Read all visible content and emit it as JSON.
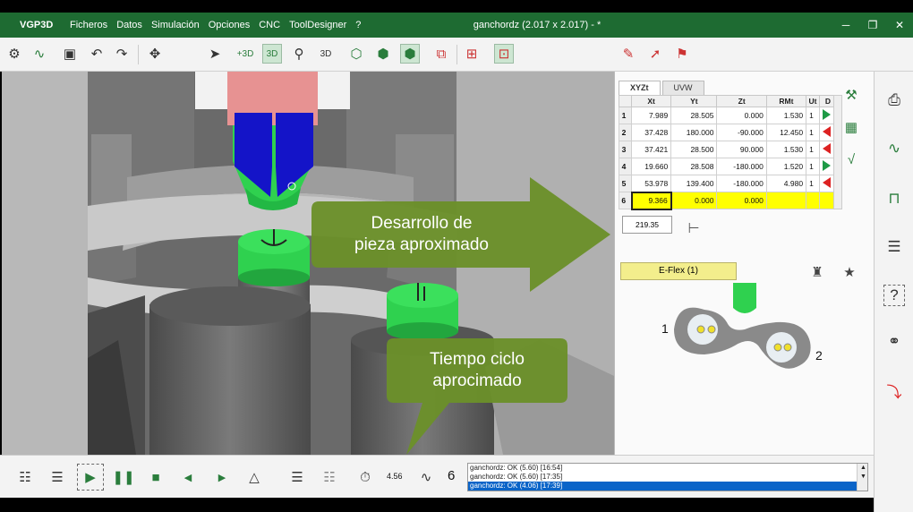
{
  "app": {
    "brand": "VGP3D",
    "menu": [
      "Ficheros",
      "Datos",
      "Simulación",
      "Opciones",
      "CNC",
      "ToolDesigner",
      "?"
    ],
    "document_title": "ganchordz (2.017 x 2.017) - *",
    "window_controls": [
      "─",
      "❐",
      "✕"
    ]
  },
  "panel": {
    "tabs": [
      "XYZt",
      "UVW"
    ],
    "table": {
      "columns": [
        "",
        "Xt",
        "Yt",
        "Zt",
        "RMt",
        "Ut",
        "D"
      ],
      "rows": [
        {
          "n": "1",
          "xt": "7.989",
          "yt": "28.505",
          "zt": "0.000",
          "rmt": "1.530",
          "ut": "1",
          "d": "right"
        },
        {
          "n": "2",
          "xt": "37.428",
          "yt": "180.000",
          "zt": "-90.000",
          "rmt": "12.450",
          "ut": "1",
          "d": "left"
        },
        {
          "n": "3",
          "xt": "37.421",
          "yt": "28.500",
          "zt": "90.000",
          "rmt": "1.530",
          "ut": "1",
          "d": "left"
        },
        {
          "n": "4",
          "xt": "19.660",
          "yt": "28.508",
          "zt": "-180.000",
          "rmt": "1.520",
          "ut": "1",
          "d": "right"
        },
        {
          "n": "5",
          "xt": "53.978",
          "yt": "139.400",
          "zt": "-180.000",
          "rmt": "4.980",
          "ut": "1",
          "d": "left"
        },
        {
          "n": "6",
          "xt": "9.366",
          "yt": "0.000",
          "zt": "0.000",
          "rmt": "",
          "ut": "",
          "d": ""
        }
      ]
    },
    "developed_length": "219.35",
    "eflex_label": "E-Flex (1)",
    "diagram_labels": [
      "1",
      "2"
    ]
  },
  "callouts": {
    "development": "Desarrollo de pieza aproximado",
    "development_line1": "Desarrollo de",
    "development_line2": "pieza aproximado",
    "cycle_line1": "Tiempo ciclo",
    "cycle_line2": "aprocimado",
    "color": "#6b8f2a"
  },
  "bottom": {
    "cycle_time": "4.56",
    "program_count": "6",
    "log": [
      "ganchordz: OK (5.60) [16:54]",
      "ganchordz: OK (5.60) [17:35]",
      "ganchordz: OK (4.06) [17:39]"
    ]
  },
  "colors": {
    "titlebar": "#1e6b32",
    "accent": "#2a7d3c",
    "part_green": "#2fd14f",
    "tool_blue": "#1414c8",
    "highlight_yellow": "#ffff00"
  }
}
